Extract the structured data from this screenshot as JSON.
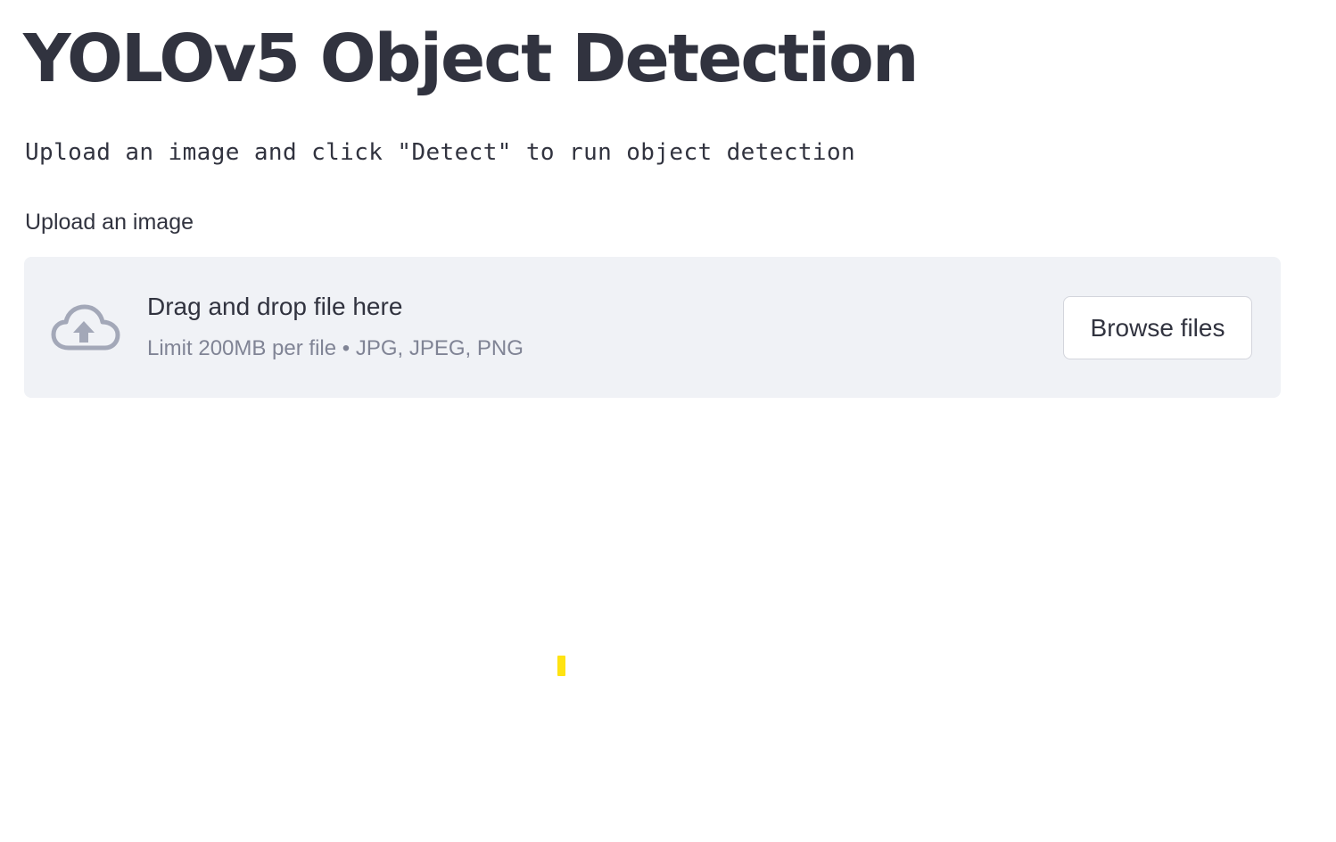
{
  "page": {
    "title": "YOLOv5 Object Detection",
    "subtitle": "Upload an image and click \"Detect\" to run object detection"
  },
  "uploader": {
    "label": "Upload an image",
    "drop_title": "Drag and drop file here",
    "limit_text": "Limit 200MB per file • JPG, JPEG, PNG",
    "browse_label": "Browse files",
    "icon": "cloud-upload-icon"
  },
  "colors": {
    "text": "#31333f",
    "muted_text": "#808495",
    "dropzone_bg": "#f0f2f6",
    "icon": "#a3a8b8",
    "loader_accent": "#ffe312"
  }
}
